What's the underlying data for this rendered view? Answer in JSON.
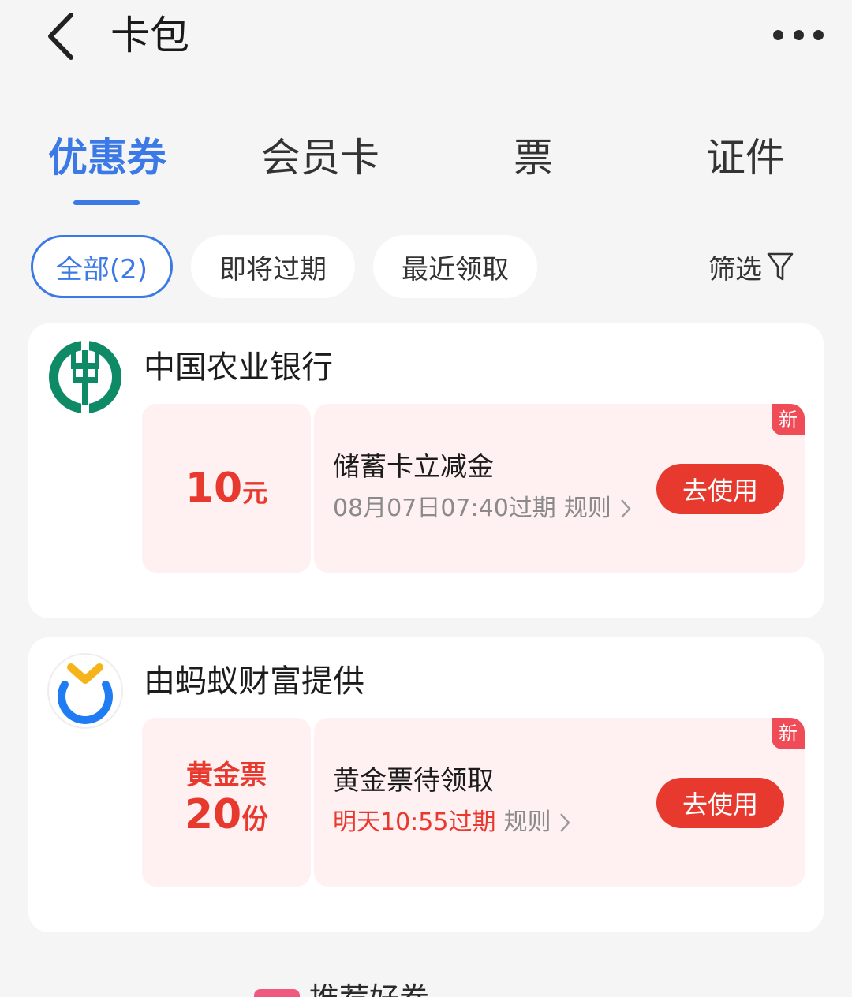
{
  "header": {
    "title": "卡包"
  },
  "tabs": [
    {
      "label": "优惠券",
      "active": true
    },
    {
      "label": "会员卡",
      "active": false
    },
    {
      "label": "票",
      "active": false
    },
    {
      "label": "证件",
      "active": false
    }
  ],
  "filters": {
    "chips": [
      {
        "label": "全部(2)",
        "active": true
      },
      {
        "label": "即将过期",
        "active": false
      },
      {
        "label": "最近领取",
        "active": false
      }
    ],
    "filter_label": "筛选"
  },
  "coupons": [
    {
      "merchant": "中国农业银行",
      "amount": "10",
      "amount_unit": "元",
      "title": "储蓄卡立减金",
      "expiry": "08月07日07:40过期",
      "rules": "规则",
      "button": "去使用",
      "badge": "新"
    },
    {
      "merchant": "由蚂蚁财富提供",
      "amount_label": "黄金票",
      "amount": "20",
      "amount_unit": "份",
      "title": "黄金票待领取",
      "expiry": "明天10:55过期",
      "rules": "规则",
      "button": "去使用",
      "badge": "新"
    }
  ],
  "footer_section": {
    "title": "推荐好券"
  },
  "colors": {
    "accent": "#3b79e6",
    "red": "#e8392f",
    "coupon_bg": "#fff0f1",
    "abc_green": "#0f8a66",
    "ant_blue": "#1f7cf2",
    "ant_yellow": "#f5b41a"
  }
}
